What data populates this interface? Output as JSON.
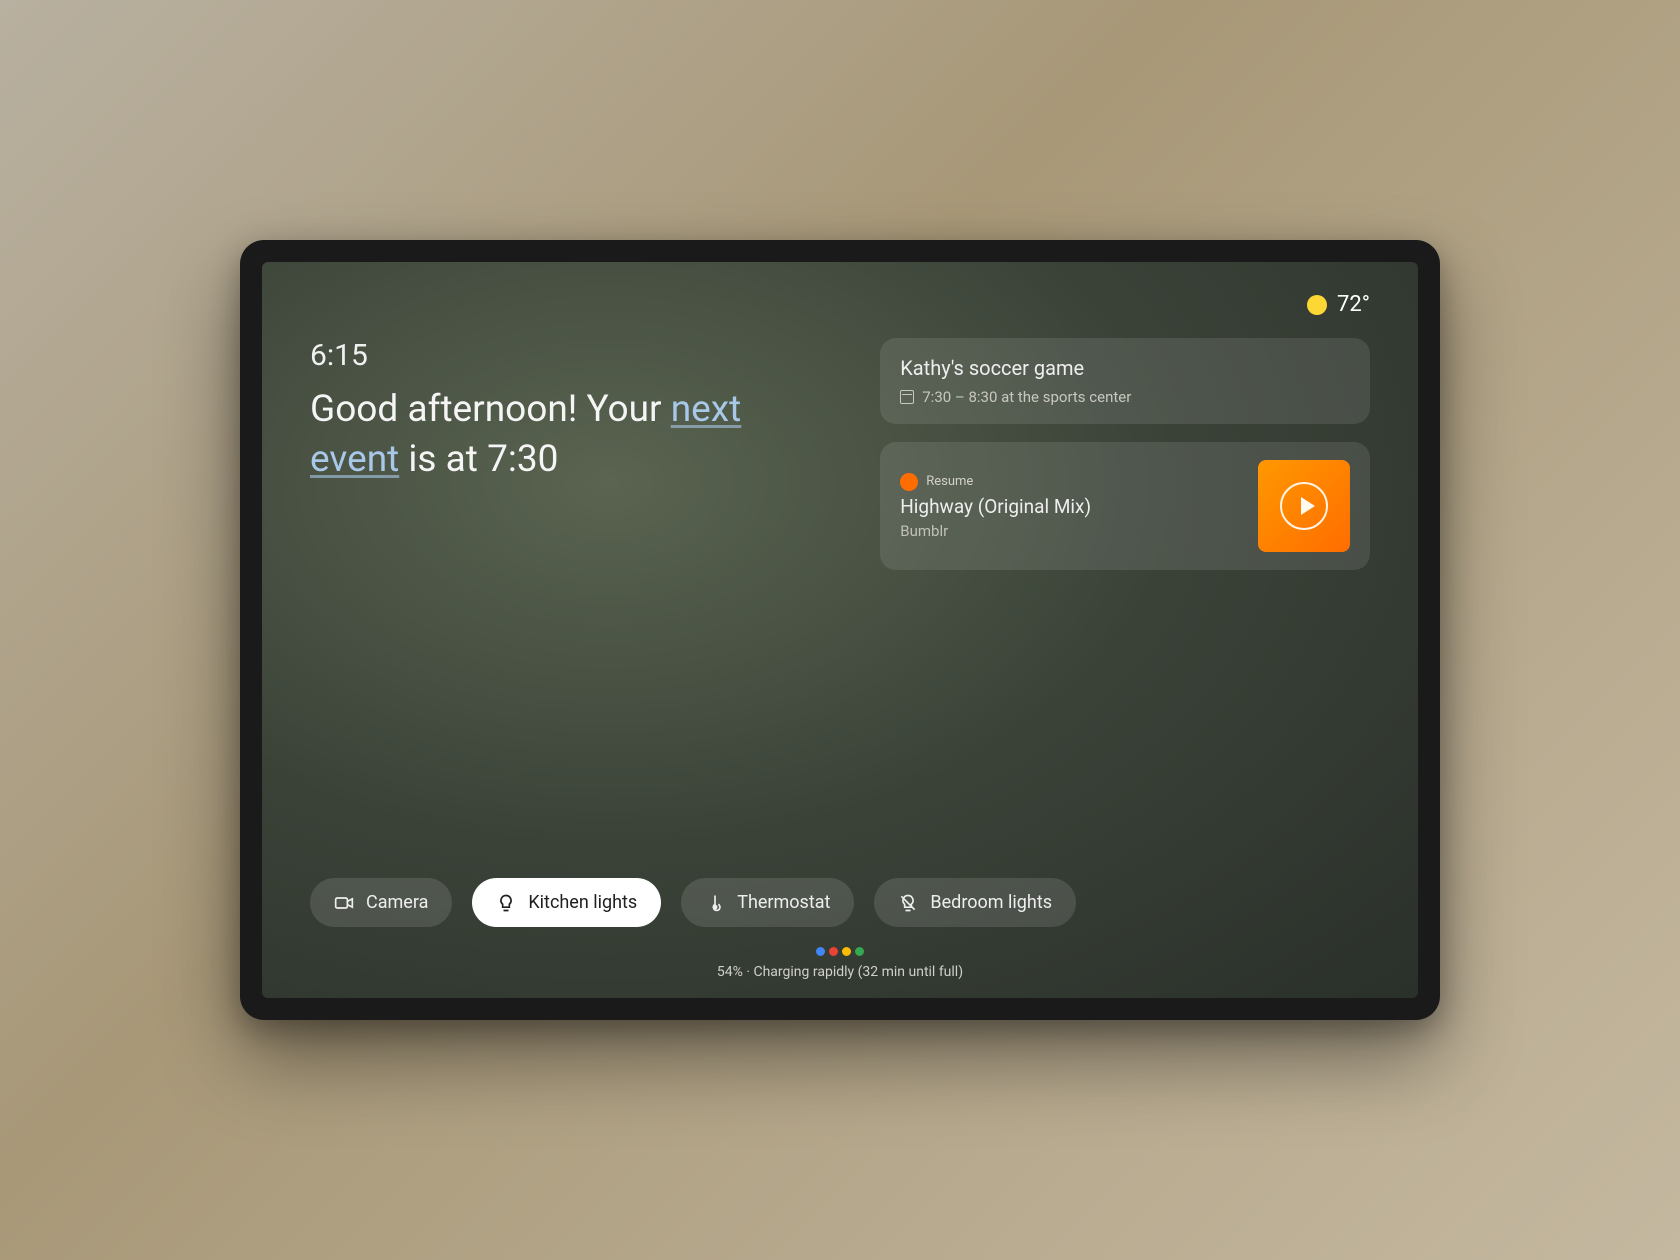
{
  "weather": {
    "temp": "72°"
  },
  "clock": "6:15",
  "greeting": {
    "prefix": "Good afternoon! Your ",
    "link": "next event",
    "suffix": " is at 7:30"
  },
  "event": {
    "title": "Kathy's soccer game",
    "detail": "7:30 – 8:30 at the sports center"
  },
  "media": {
    "label": "Resume",
    "title": "Highway (Original Mix)",
    "artist": "Bumblr"
  },
  "chips": {
    "camera": "Camera",
    "kitchen": "Kitchen lights",
    "thermostat": "Thermostat",
    "bedroom": "Bedroom lights"
  },
  "status": "54% · Charging rapidly (32 min until full)"
}
